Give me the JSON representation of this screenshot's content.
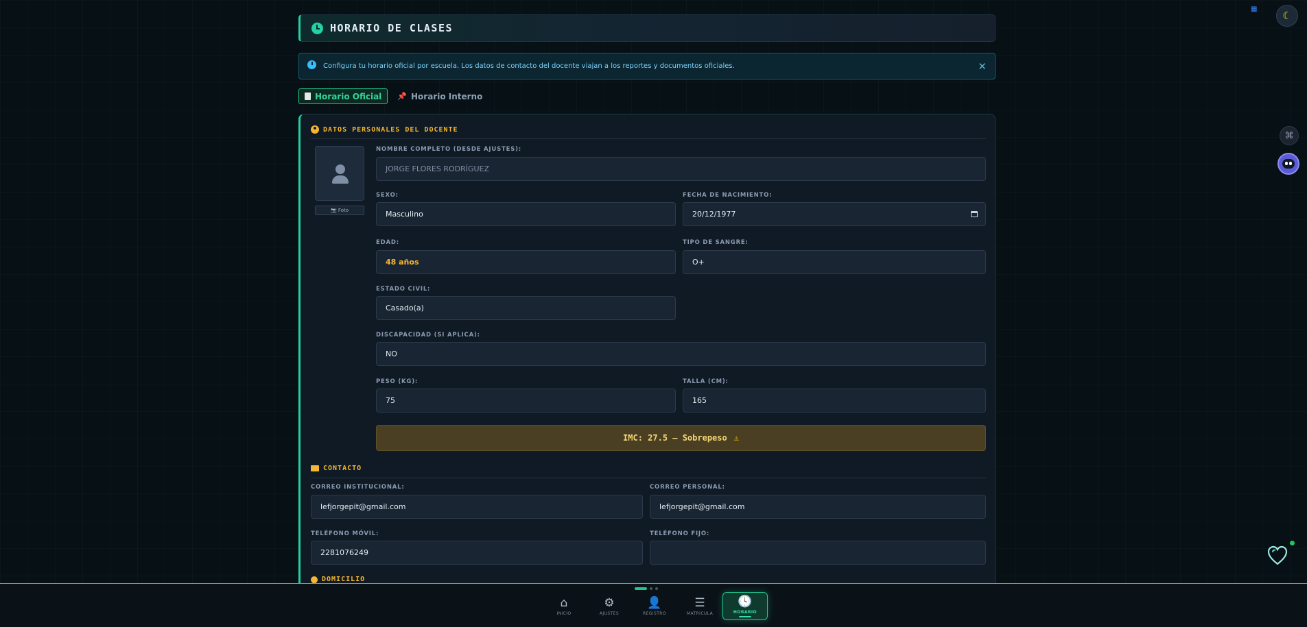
{
  "header": {
    "title": "HORARIO DE CLASES"
  },
  "info": {
    "text": "Configura tu horario oficial por escuela. Los datos de contacto del docente viajan a los reportes y documentos oficiales.",
    "close": "✕"
  },
  "tabs": [
    {
      "label": "Horario Oficial",
      "active": true
    },
    {
      "label": "Horario Interno",
      "active": false
    }
  ],
  "personal": {
    "section_title": "DATOS PERSONALES DEL DOCENTE",
    "photo_label": "📷 Foto",
    "nombre": {
      "label": "NOMBRE COMPLETO (DESDE AJUSTES):",
      "value": "JORGE FLORES RODRÍGUEZ"
    },
    "sexo": {
      "label": "SEXO:",
      "value": "Masculino"
    },
    "fecha_nacimiento": {
      "label": "FECHA DE NACIMIENTO:",
      "value": "20/12/1977"
    },
    "edad": {
      "label": "EDAD:",
      "value": "48 años"
    },
    "tipo_sangre": {
      "label": "TIPO DE SANGRE:",
      "value": "O+"
    },
    "estado_civil": {
      "label": "ESTADO CIVIL:",
      "value": "Casado(a)"
    },
    "discapacidad": {
      "label": "DISCAPACIDAD (SI APLICA):",
      "value": "NO"
    },
    "peso": {
      "label": "PESO (KG):",
      "value": "75"
    },
    "talla": {
      "label": "TALLA (CM):",
      "value": "165"
    },
    "imc": {
      "text": "IMC: 27.5 — Sobrepeso",
      "icon": "warning-icon"
    }
  },
  "contacto": {
    "section_title": "CONTACTO",
    "correo_institucional": {
      "label": "CORREO INSTITUCIONAL:",
      "value": "lefjorgepit@gmail.com"
    },
    "correo_personal": {
      "label": "CORREO PERSONAL:",
      "value": "lefjorgepit@gmail.com"
    },
    "telefono_movil": {
      "label": "TELÉFONO MÓVIL:",
      "value": "2281076249"
    },
    "telefono_fijo": {
      "label": "TELÉFONO FIJO:",
      "value": ""
    }
  },
  "domicilio": {
    "section_title": "DOMICILIO"
  },
  "nav": [
    {
      "label": "INICIO",
      "icon": "home-icon",
      "glyph": "⌂",
      "active": false
    },
    {
      "label": "AJUSTES",
      "icon": "gear-icon",
      "glyph": "⚙",
      "active": false
    },
    {
      "label": "REGISTRO",
      "icon": "user-plus-icon",
      "glyph": "👤",
      "active": false
    },
    {
      "label": "MATRÍCULA",
      "icon": "list-icon",
      "glyph": "☰",
      "active": false
    },
    {
      "label": "HORARIO",
      "icon": "clock-icon",
      "glyph": "🕓",
      "active": true
    }
  ],
  "colors": {
    "accent": "#22d3a0",
    "section": "#f5b731",
    "info": "#7dd3fc",
    "imc_bg": "#4a3f22"
  }
}
